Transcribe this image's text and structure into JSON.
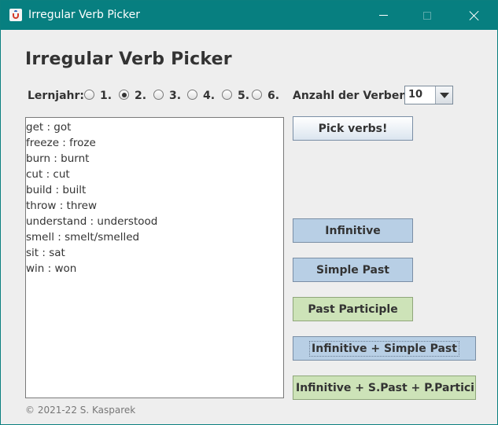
{
  "window": {
    "title": "Irregular Verb Picker",
    "icon": "java-icon"
  },
  "heading": "Irregular Verb Picker",
  "lernjahr": {
    "label": "Lernjahr:",
    "options": [
      "1.",
      "2.",
      "3.",
      "4.",
      "5.",
      "6."
    ],
    "selected": "2."
  },
  "anzahl": {
    "label": "Anzahl der Verben",
    "value": "10"
  },
  "verbs": [
    "get : got",
    "freeze : froze",
    "burn : burnt",
    "cut : cut",
    "build : built",
    "throw : threw",
    "understand : understood",
    "smell : smelt/smelled",
    "sit : sat",
    "win : won"
  ],
  "buttons": {
    "pick": "Pick verbs!",
    "infinitive": "Infinitive",
    "simple_past": "Simple Past",
    "past_participle": "Past Participle",
    "inf_simple_past": "Infinitive + Simple Past",
    "inf_all": "Infinitive + S.Past + P.Participl..."
  },
  "footer": "© 2021-22 S. Kasparek",
  "colors": {
    "titlebar": "#077f80",
    "button_blue": "#b8cfe5",
    "button_green": "#cde3b8"
  }
}
